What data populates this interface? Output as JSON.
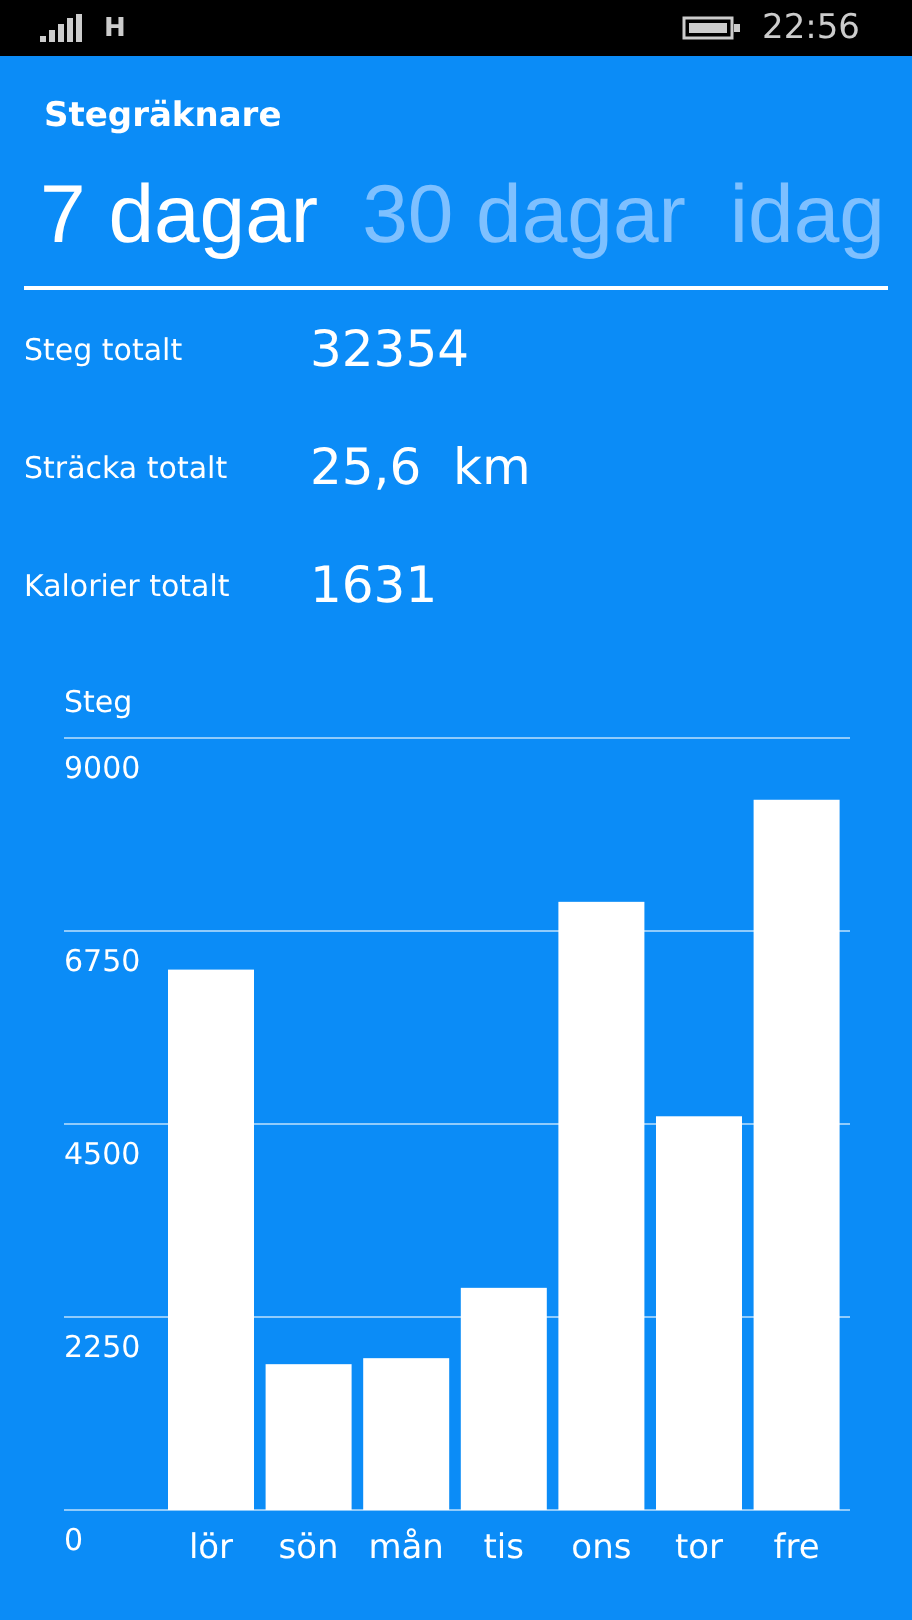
{
  "status_bar": {
    "network": "H",
    "time": "22:56"
  },
  "app_title": "Stegräknare",
  "tabs": [
    {
      "label": "7 dagar",
      "selected": true
    },
    {
      "label": "30 dagar",
      "selected": false
    },
    {
      "label": "idag",
      "selected": false
    }
  ],
  "stats": [
    {
      "label": "Steg totalt",
      "value": "32354"
    },
    {
      "label": "Sträcka totalt",
      "value": "25,6  km"
    },
    {
      "label": "Kalorier totalt",
      "value": "1631"
    }
  ],
  "chart_data": {
    "type": "bar",
    "ylabel": "Steg",
    "categories": [
      "lör",
      "sön",
      "mån",
      "tis",
      "ons",
      "tor",
      "fre"
    ],
    "values": [
      6300,
      1700,
      1770,
      2590,
      7090,
      4590,
      8280
    ],
    "ylim": [
      0,
      9000
    ],
    "grid": true,
    "yticks": [
      0,
      2250,
      4500,
      6750,
      9000
    ]
  }
}
